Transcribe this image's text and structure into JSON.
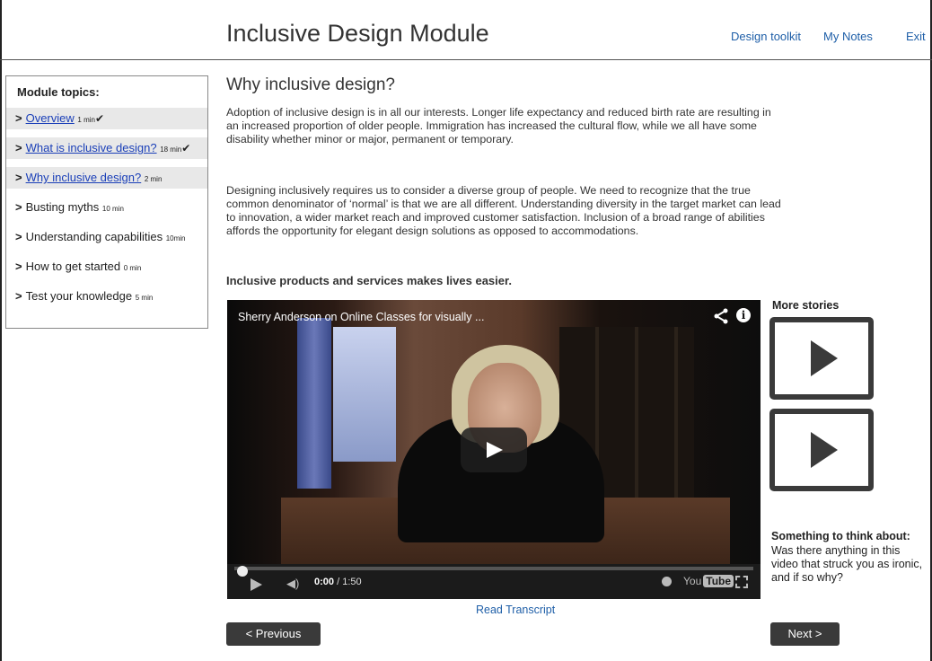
{
  "header": {
    "title": "Inclusive Design Module",
    "links": [
      "Design toolkit",
      "My Notes",
      "Exit"
    ]
  },
  "sidebar": {
    "heading": "Module topics:",
    "items": [
      {
        "label": "Overview",
        "duration": "1 min",
        "visited": true,
        "check": "✔"
      },
      {
        "label": "What is inclusive design?",
        "duration": "18 min",
        "visited": true,
        "check": "✔"
      },
      {
        "label": "Why inclusive design?",
        "duration": "2 min",
        "visited": true,
        "check": ""
      },
      {
        "label": "Busting myths",
        "duration": "10 min",
        "visited": false,
        "check": ""
      },
      {
        "label": "Understanding capabilities",
        "duration": "10min",
        "visited": false,
        "check": ""
      },
      {
        "label": "How to get started",
        "duration": "0 min",
        "visited": false,
        "check": ""
      },
      {
        "label": "Test your knowledge",
        "duration": "5 min",
        "visited": false,
        "check": ""
      }
    ]
  },
  "main": {
    "title": "Why inclusive design?",
    "para1": "Adoption of inclusive design is in all our interests. Longer life expectancy and reduced birth rate are resulting in an increased proportion of older people. Immigration has increased the cultural flow, while we all have some disability whether minor or major, permanent or temporary.",
    "para2": "Designing inclusively requires us to consider a diverse group of people. We need to recognize that the true common denominator of ‘normal’ is that we are all different. Understanding diversity in the target market can lead to innovation, a wider market reach and improved customer satisfaction. Inclusion of a broad range of abilities affords the opportunity for elegant design solutions as opposed to accommodations.",
    "bold_line": "Inclusive products and services makes lives easier."
  },
  "video": {
    "title": "Sherry Anderson on Online Classes for visually ...",
    "current_time": "0:00",
    "total_time": "/ 1:50",
    "progress": 0,
    "logo_you": "You",
    "logo_tube": "Tube",
    "transcript_link": "Read Transcript"
  },
  "right": {
    "more_stories": "More stories",
    "think_title": "Something to think about:",
    "think_text": "Was there anything in this video that struck you as ironic, and if so why?"
  },
  "nav": {
    "previous": "< Previous",
    "next": "Next >"
  },
  "icons": {
    "share": "share-icon",
    "info": "info-icon",
    "play": "play-icon",
    "volume": "volume-icon",
    "clock": "watch-later-icon",
    "fullscreen": "fullscreen-icon",
    "check": "checkmark-icon"
  },
  "colors": {
    "link": "#1f5fa8",
    "topic_link": "#1a3fb8",
    "button_bg": "#3a3a3a",
    "visited_bg": "#e8e8e8"
  }
}
